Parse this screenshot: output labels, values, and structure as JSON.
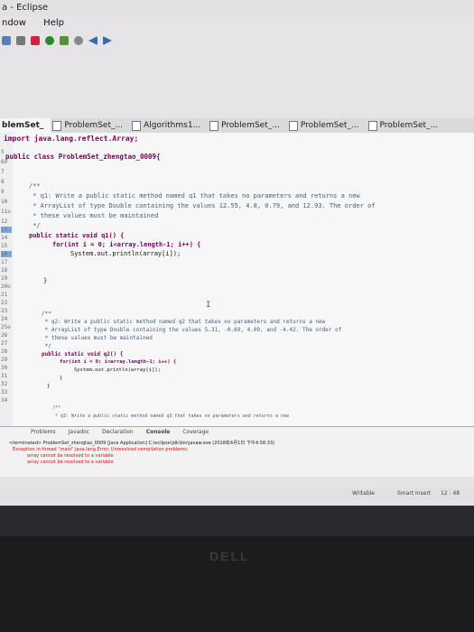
{
  "window": {
    "title": "a - Eclipse"
  },
  "menu": [
    "ndow",
    "Help"
  ],
  "toolbar_icons": [
    "save-icon",
    "print-icon",
    "debug-icon",
    "run-icon",
    "new-class-icon",
    "search-icon",
    "back-icon",
    "forward-icon"
  ],
  "tabs": [
    {
      "label": "blemSet_"
    },
    {
      "label": "ProblemSet_..."
    },
    {
      "label": "Algorithms1..."
    },
    {
      "label": "ProblemSet_..."
    },
    {
      "label": "ProblemSet_..."
    },
    {
      "label": "ProblemSet_..."
    }
  ],
  "editor": {
    "gutter": [
      "5",
      "6⊖",
      "7",
      "8",
      "9",
      "10",
      "11⊖",
      "12",
      "13",
      "14",
      "15",
      "16",
      "17",
      "18",
      "19",
      "20⊖",
      "21",
      "22",
      "23",
      "24",
      "25⊖",
      "26",
      "27",
      "28",
      "29",
      "30",
      "31",
      "32",
      "33",
      "34"
    ],
    "lines": {
      "l0": "import java.lang.reflect.Array;",
      "l1": "public class ProblemSet_zhengtao_0009{",
      "l2": "/**",
      "l3": " * q1: Write a public static method named q1 that takes no parameters and returns a new",
      "l4": " * ArrayList of type Double containing the values 12.55, 4.8, 0.79, and 12.93. The order of",
      "l5": " * these values must be maintained",
      "l6": " */",
      "l7": "public static void q1() {",
      "l8": "for(int i = 0; i<array.length-1; i++) {",
      "l9": "System.out.println(array[i]);",
      "l10": "}",
      "l11": "I",
      "l12": "/**",
      "l13": " * q2: Write a public static method named q2 that takes no parameters and returns a new",
      "l14": " * ArrayList of type Double containing the values 5.31, -0.69, 4.09, and -4.42. The order of",
      "l15": " * these values must be maintained",
      "l16": " */",
      "l17": "public static void q2() {",
      "l18": "for(int i = 0; i<array.length-1; i++) {",
      "l19": "System.out.println(array[i]);",
      "l20": "}",
      "l21": "}",
      "l22": "/**",
      "l23": " * q3: Write a public static method named q3 that takes no parameters and returns a new"
    }
  },
  "console": {
    "tabs": [
      "Problems",
      "Javadoc",
      "Declaration",
      "Console",
      "Coverage"
    ],
    "header": "<terminated> ProblemSet_zhengtao_0009 [Java Application] C:\\eclipse\\jdk\\bin\\javaw.exe (2018年4月1日 下午4:58:33)",
    "error1": "Exception in thread \"main\" java.lang.Error: Unresolved compilation problems:",
    "error2": "array cannot be resolved to a variable",
    "error3": "array cannot be resolved to a variable"
  },
  "status": {
    "mode": "Writable",
    "insert": "Smart Insert",
    "position": "12 : 48"
  },
  "bezel": {
    "brand": "DELL"
  }
}
